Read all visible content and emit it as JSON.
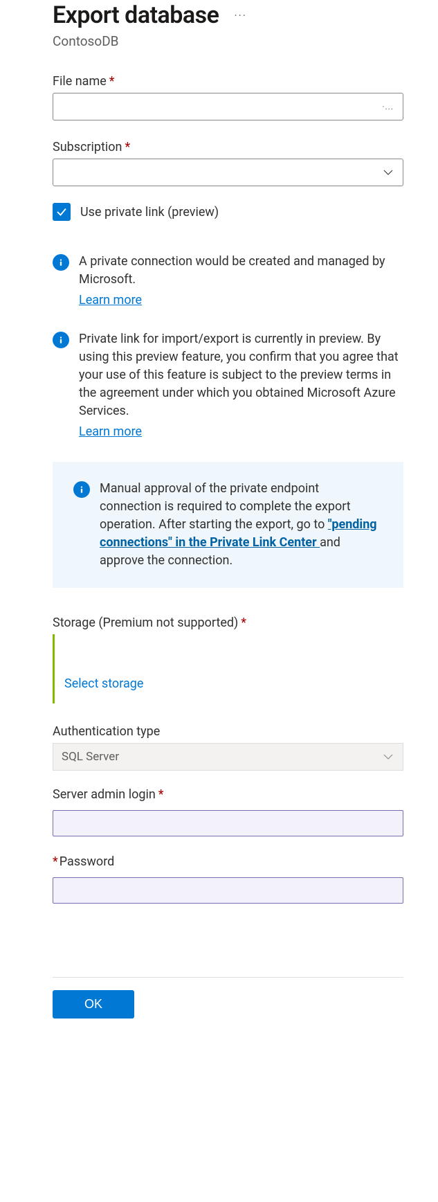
{
  "header": {
    "title": "Export database",
    "subtitle": "ContosoDB"
  },
  "fields": {
    "filename_label": "File name",
    "filename_value": "",
    "filename_suffix": "·...",
    "subscription_label": "Subscription",
    "subscription_value": "",
    "private_link_label": "Use private link (preview)",
    "private_link_checked": true,
    "storage_label": "Storage (Premium not supported)",
    "select_storage_link": "Select storage",
    "auth_type_label": "Authentication type",
    "auth_type_value": "SQL Server",
    "admin_login_label": "Server admin login",
    "admin_login_value": "",
    "password_label": "Password",
    "password_value": ""
  },
  "info": {
    "msg1_text": "A private connection would be created and managed by Microsoft.",
    "msg1_link": "Learn more",
    "msg2_text": "Private link for import/export is currently in preview. By using this preview feature, you confirm that you agree that your use of this feature is subject to the preview terms in the agreement under which you obtained Microsoft Azure Services.",
    "msg2_link": "Learn more",
    "callout_pre": "Manual approval of the private endpoint connection is required to complete the export operation. After starting the export, go to ",
    "callout_link": "\"pending connections\" in the Private Link Center ",
    "callout_post": "and approve the connection."
  },
  "footer": {
    "ok_label": "OK"
  }
}
